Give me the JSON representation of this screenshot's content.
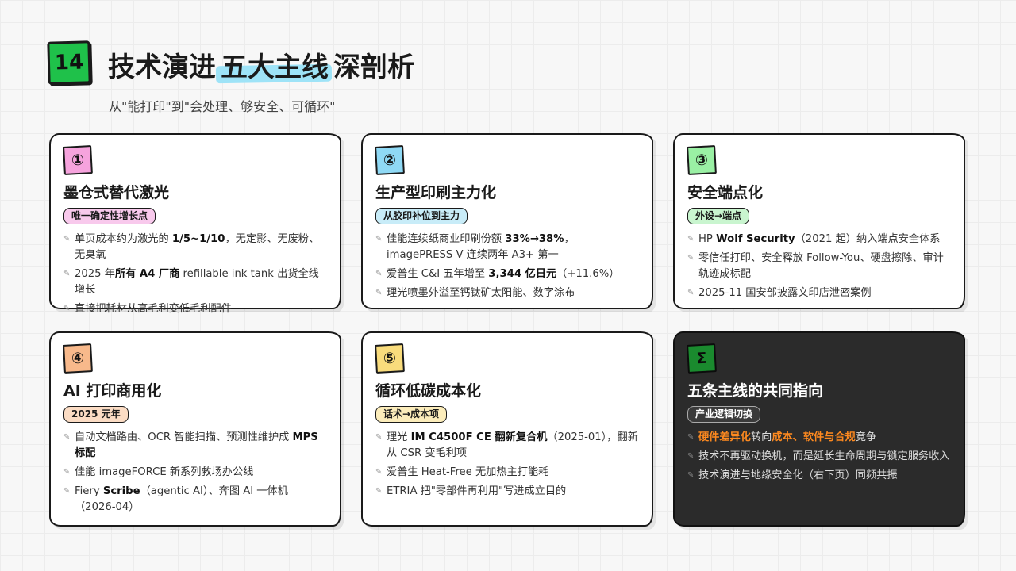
{
  "header": {
    "page_number": "14",
    "title_before": "技术演进",
    "title_highlight": "五大主线",
    "title_after": "深剖析",
    "subtitle": "从\"能打印\"到\"会处理、够安全、可循环\""
  },
  "colors": {
    "green": "#1fc14a",
    "highlight_blue": "#9ee3f7",
    "badge_pink": "#f6a3dd",
    "badge_blue": "#8fd9f5",
    "badge_green": "#9af0a4",
    "badge_orange": "#f8b98b",
    "badge_yellow": "#f9dc7c",
    "dark_card": "#2b2b2b",
    "accent_orange": "#ff8a1f"
  },
  "cards": [
    {
      "badge": "①",
      "badge_color": "#f6a3dd",
      "title": "墨仓式替代激光",
      "tag": "唯一确定性增长点",
      "tag_color": "#f8c9ec",
      "bullets": [
        [
          "单页成本约为激光的 ",
          "1/5~1/10",
          "，无定影、无废粉、无臭氧"
        ],
        [
          "2025 年",
          "所有 A4 厂商",
          " refillable ink tank 出货全线增长"
        ],
        [
          "直接把耗材从高毛利变低毛利配件"
        ]
      ]
    },
    {
      "badge": "②",
      "badge_color": "#8fd9f5",
      "title": "生产型印刷主力化",
      "tag": "从胶印补位到主力",
      "tag_color": "#c8ecf8",
      "bullets": [
        [
          "佳能连续纸商业印刷份额 ",
          "33%→38%",
          "，imagePRESS V 连续两年 A3+ 第一"
        ],
        [
          "爱普生 C&I 五年增至 ",
          "3,344 亿日元",
          "（+11.6%）"
        ],
        [
          "理光喷墨外溢至钙钛矿太阳能、数字涂布"
        ]
      ]
    },
    {
      "badge": "③",
      "badge_color": "#9af0a4",
      "title": "安全端点化",
      "tag": "外设→端点",
      "tag_color": "#c9f5cf",
      "bullets": [
        [
          "HP ",
          "Wolf Security",
          "（2021 起）纳入端点安全体系"
        ],
        [
          "零信任打印、安全释放 Follow-You、硬盘擦除、审计轨迹成标配"
        ],
        [
          "2025-11 国安部披露文印店泄密案例"
        ]
      ]
    },
    {
      "badge": "④",
      "badge_color": "#f8b98b",
      "title": "AI 打印商用化",
      "tag": "2025 元年",
      "tag_color": "#fbdcc4",
      "bullets": [
        [
          "自动文档路由、OCR 智能扫描、预测性维护成 ",
          "MPS 标配",
          ""
        ],
        [
          "佳能 imageFORCE 新系列救场办公线"
        ],
        [
          "Fiery ",
          "Scribe",
          "（agentic AI）、奔图 AI 一体机（2026-04）"
        ]
      ]
    },
    {
      "badge": "⑤",
      "badge_color": "#f9dc7c",
      "title": "循环低碳成本化",
      "tag": "话术→成本项",
      "tag_color": "#fcedbb",
      "bullets": [
        [
          "理光 ",
          "IM C4500F CE 翻新复合机",
          "（2025-01），翻新从 CSR 变毛利项"
        ],
        [
          "爱普生 Heat-Free 无加热主打能耗"
        ],
        [
          "ETRIA 把\"零部件再利用\"写进成立目的"
        ]
      ]
    },
    {
      "badge": "Σ",
      "badge_color": "#1a8a2e",
      "title": "五条主线的共同指向",
      "tag": "产业逻辑切换",
      "tag_color": "#3a3a3a",
      "bullets": [
        [
          "",
          "硬件差异化",
          "转向",
          "成本、软件与合规",
          "竞争"
        ],
        [
          "技术不再驱动换机，而是延长生命周期与锁定服务收入"
        ],
        [
          "技术演进与地缘安全化（右下页）同频共振"
        ]
      ]
    }
  ]
}
